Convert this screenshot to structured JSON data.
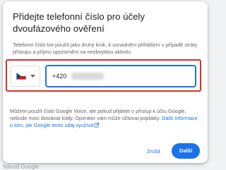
{
  "dialog": {
    "title": "Přidejte telefonní číslo pro účely dvoufázového ověření",
    "description": "Telefonní číslo lze použít jako druhý krok, k usnadnění přihlášení v případě ztráty přístupu a příjmu upozornění na neobvyklou aktivitu",
    "country": {
      "flag_icon": "czech-flag-icon",
      "caret_icon": "dropdown-caret-icon"
    },
    "phone_input": {
      "prefix": "+420"
    },
    "info": {
      "text": "Můžete použít číslo Google Voice, ale pokud přijdete o přístup k účtu Google, nebude moci dostávat kódy. Operátor vám může účtovat poplatky.",
      "link": "Další informace o tom, jak Google tento údaj využívá"
    },
    "buttons": {
      "cancel": "Zrušit",
      "next": "Další"
    }
  },
  "colors": {
    "accent": "#1a73e8",
    "highlight_border": "#d93025"
  },
  "background": {
    "text": "Návod Google"
  }
}
